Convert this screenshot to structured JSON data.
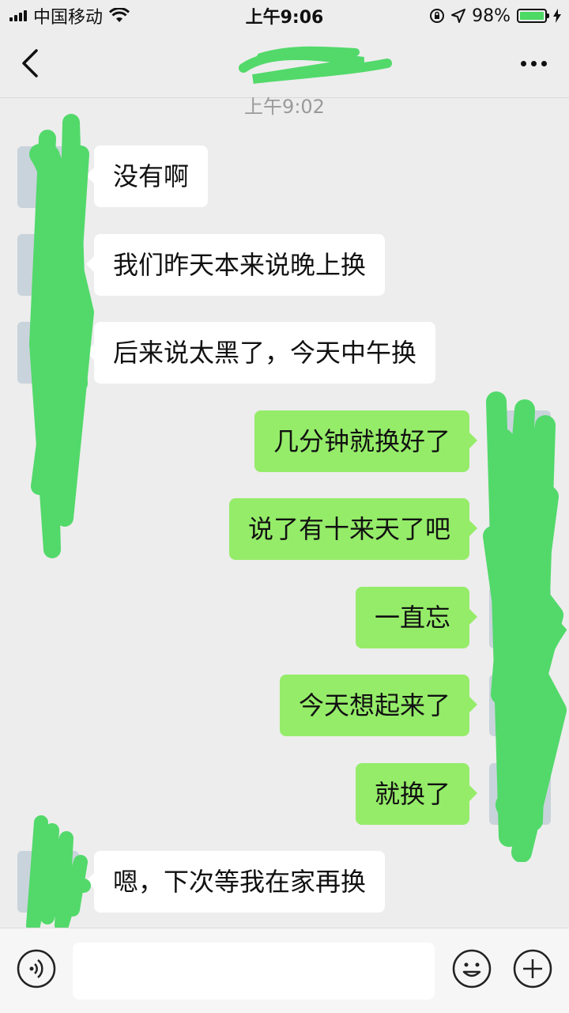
{
  "status_bar": {
    "carrier": "中国移动",
    "time": "上午9:06",
    "battery_percent": "98%",
    "battery_level": 0.98,
    "battery_color": "#4cd964"
  },
  "nav": {
    "back_icon": "chevron-left-icon",
    "more_icon": "more-dots-icon"
  },
  "timestamp": "上午9:02",
  "messages": [
    {
      "side": "left",
      "text": "没有啊"
    },
    {
      "side": "left",
      "text": "我们昨天本来说晚上换"
    },
    {
      "side": "left",
      "text": "后来说太黑了，今天中午换"
    },
    {
      "side": "right",
      "text": "几分钟就换好了"
    },
    {
      "side": "right",
      "text": "说了有十来天了吧"
    },
    {
      "side": "right",
      "text": "一直忘"
    },
    {
      "side": "right",
      "text": "今天想起来了"
    },
    {
      "side": "right",
      "text": "就换了"
    },
    {
      "side": "left",
      "text": "嗯，下次等我在家再换"
    }
  ],
  "input_bar": {
    "voice_icon": "voice-icon",
    "emoji_icon": "emoji-icon",
    "plus_icon": "plus-icon",
    "input_value": ""
  },
  "colors": {
    "background": "#ededed",
    "bubble_self": "#95ec69",
    "bubble_other": "#ffffff",
    "redaction": "#52d96a"
  }
}
